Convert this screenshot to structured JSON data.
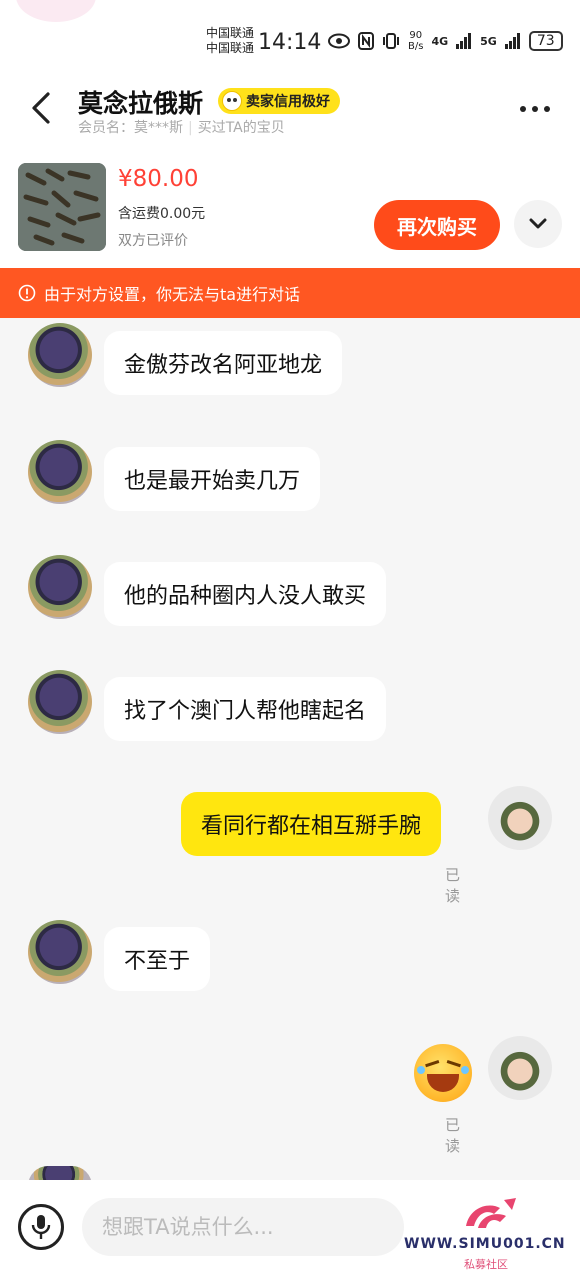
{
  "status_bar": {
    "carrier_1": "中国联通",
    "carrier_2": "中国联通",
    "time": "14:14",
    "net_speed_value": "90",
    "net_speed_unit": "B/s",
    "signal_1": "4G",
    "signal_2": "5G",
    "battery": "73"
  },
  "header": {
    "seller_name": "莫念拉俄斯",
    "credit_badge": "卖家信用极好",
    "member_name": "会员名：莫***斯",
    "purchase_note": "买过TA的宝贝"
  },
  "product": {
    "price": "¥80.00",
    "shipping": "含运费0.00元",
    "review_status": "双方已评价",
    "buy_again_label": "再次购买"
  },
  "notice": {
    "text": "由于对方设置，你无法与ta进行对话"
  },
  "messages": [
    {
      "sender": "seller",
      "text": "金傲芬改名阿亚地龙"
    },
    {
      "sender": "seller",
      "text": "也是最开始卖几万"
    },
    {
      "sender": "seller",
      "text": "他的品种圈内人没人敢买"
    },
    {
      "sender": "seller",
      "text": "找了个澳门人帮他瞎起名"
    },
    {
      "sender": "me",
      "text": "看同行都在相互掰手腕",
      "status": "已读"
    },
    {
      "sender": "seller",
      "text": "不至于"
    },
    {
      "sender": "me",
      "emoji": "laughing-tears-emoji",
      "status": "已读"
    }
  ],
  "input": {
    "placeholder": "想跟TA说点什么..."
  },
  "watermark": {
    "url": "WWW.SIMU001.CN",
    "subtitle": "私募社区"
  },
  "colors": {
    "accent_orange": "#ff5722",
    "price_red": "#ff4136",
    "my_bubble_yellow": "#ffe60f",
    "badge_yellow": "#ffe11a"
  }
}
